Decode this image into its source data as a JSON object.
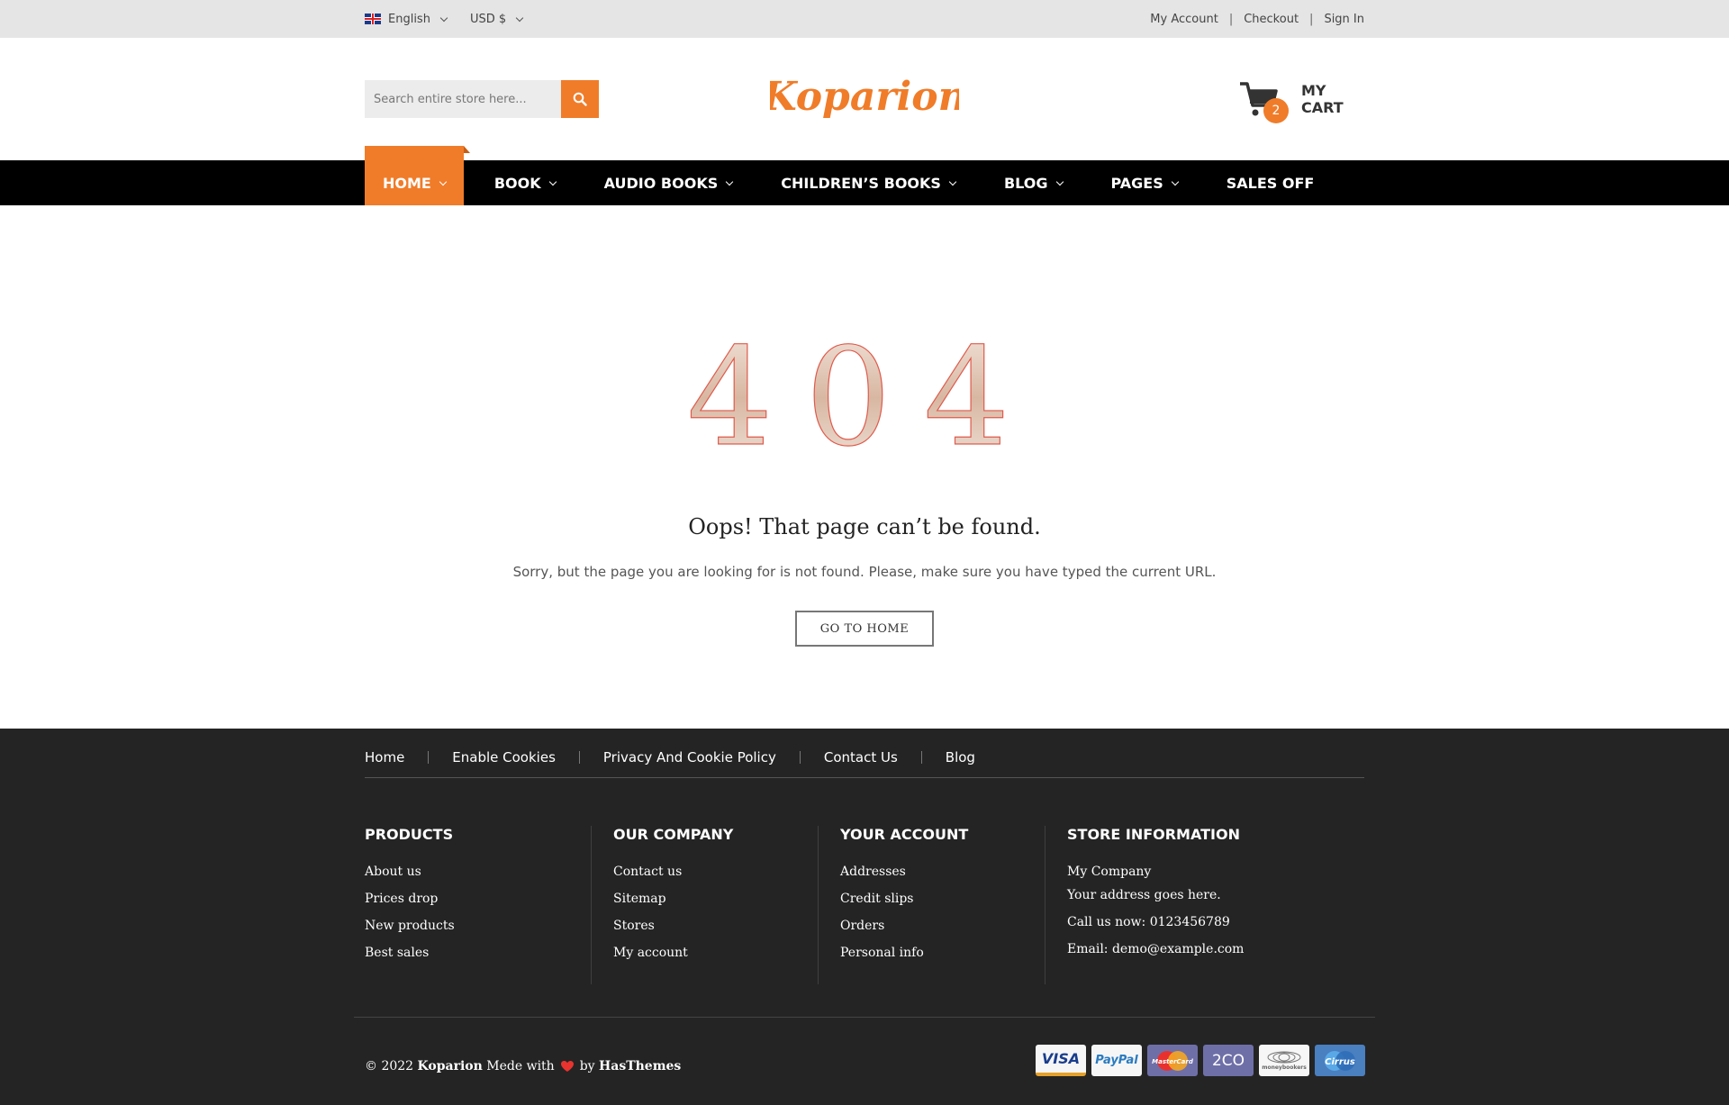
{
  "topbar": {
    "language": "English",
    "currency": "USD $",
    "links": [
      "My Account",
      "Checkout",
      "Sign In"
    ],
    "separator": "|"
  },
  "header": {
    "search_placeholder": "Search entire store here...",
    "logo_text": "Koparion",
    "cart_count": "2",
    "cart_label": "MY CART"
  },
  "nav": {
    "items": [
      {
        "label": "HOME",
        "active": true,
        "dropdown": true
      },
      {
        "label": "BOOK",
        "dropdown": true
      },
      {
        "label": "AUDIO BOOKS",
        "dropdown": true
      },
      {
        "label": "CHILDREN’S BOOKS",
        "dropdown": true
      },
      {
        "label": "BLOG",
        "dropdown": true
      },
      {
        "label": "PAGES",
        "dropdown": true
      },
      {
        "label": "SALES OFF",
        "dropdown": false
      }
    ]
  },
  "error": {
    "code": "404",
    "title": "Oops! That page can’t be found.",
    "message": "Sorry, but the page you are looking for is not found. Please, make sure you have typed the current URL.",
    "button": "GO TO HOME"
  },
  "footer": {
    "links": [
      "Home",
      "Enable Cookies",
      "Privacy And Cookie Policy",
      "Contact Us",
      "Blog"
    ],
    "columns": [
      {
        "title": "PRODUCTS",
        "items": [
          "About us",
          "Prices drop",
          "New products",
          "Best sales"
        ]
      },
      {
        "title": "OUR COMPANY",
        "items": [
          "Contact us",
          "Sitemap",
          "Stores",
          "My account"
        ]
      },
      {
        "title": "YOUR ACCOUNT",
        "items": [
          "Addresses",
          "Credit slips",
          "Orders",
          "Personal info"
        ]
      }
    ],
    "store": {
      "title": "STORE INFORMATION",
      "company": "My Company",
      "address": "Your address goes here.",
      "phone": "Call us now: 0123456789",
      "email": "Email: demo@example.com"
    },
    "copyright": {
      "prefix": "© 2022",
      "brand": "Koparion",
      "made": "Mede with",
      "by": "by",
      "author": "HasThemes"
    },
    "payments": [
      "VISA",
      "PayPal",
      "MasterCard",
      "2CO",
      "moneybookers",
      "Cirrus"
    ]
  },
  "colors": {
    "accent": "#f07c29",
    "nav_bg": "#000000",
    "footer_bg": "#242424",
    "topbar_bg": "#e5e5e5"
  }
}
